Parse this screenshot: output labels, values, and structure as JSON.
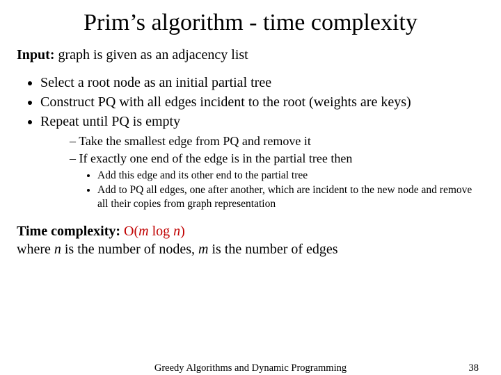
{
  "title": "Prim’s algorithm - time complexity",
  "input": {
    "label": "Input:",
    "text": " graph is given as an adjacency list"
  },
  "steps": [
    "Select a root node as an initial partial tree",
    "Construct PQ with all edges incident to the root (weights are keys)",
    "Repeat until PQ is empty"
  ],
  "loop": [
    "Take the smallest edge from PQ and remove it",
    "If exactly one end of the edge is in the partial tree then"
  ],
  "inner": [
    "Add this edge and its other end to the partial tree",
    "Add to PQ all edges, one after another, which are incident to the new node and remove all their copies from graph representation"
  ],
  "complexity": {
    "label": "Time complexity: ",
    "o1": "O(",
    "m": "m ",
    "log": "log ",
    "n": "n",
    "close": ")",
    "line2a": "where ",
    "line2b": " is the number of nodes, ",
    "line2c": " is the number of edges"
  },
  "footer": {
    "text": "Greedy Algorithms and Dynamic Programming",
    "page": "38"
  }
}
